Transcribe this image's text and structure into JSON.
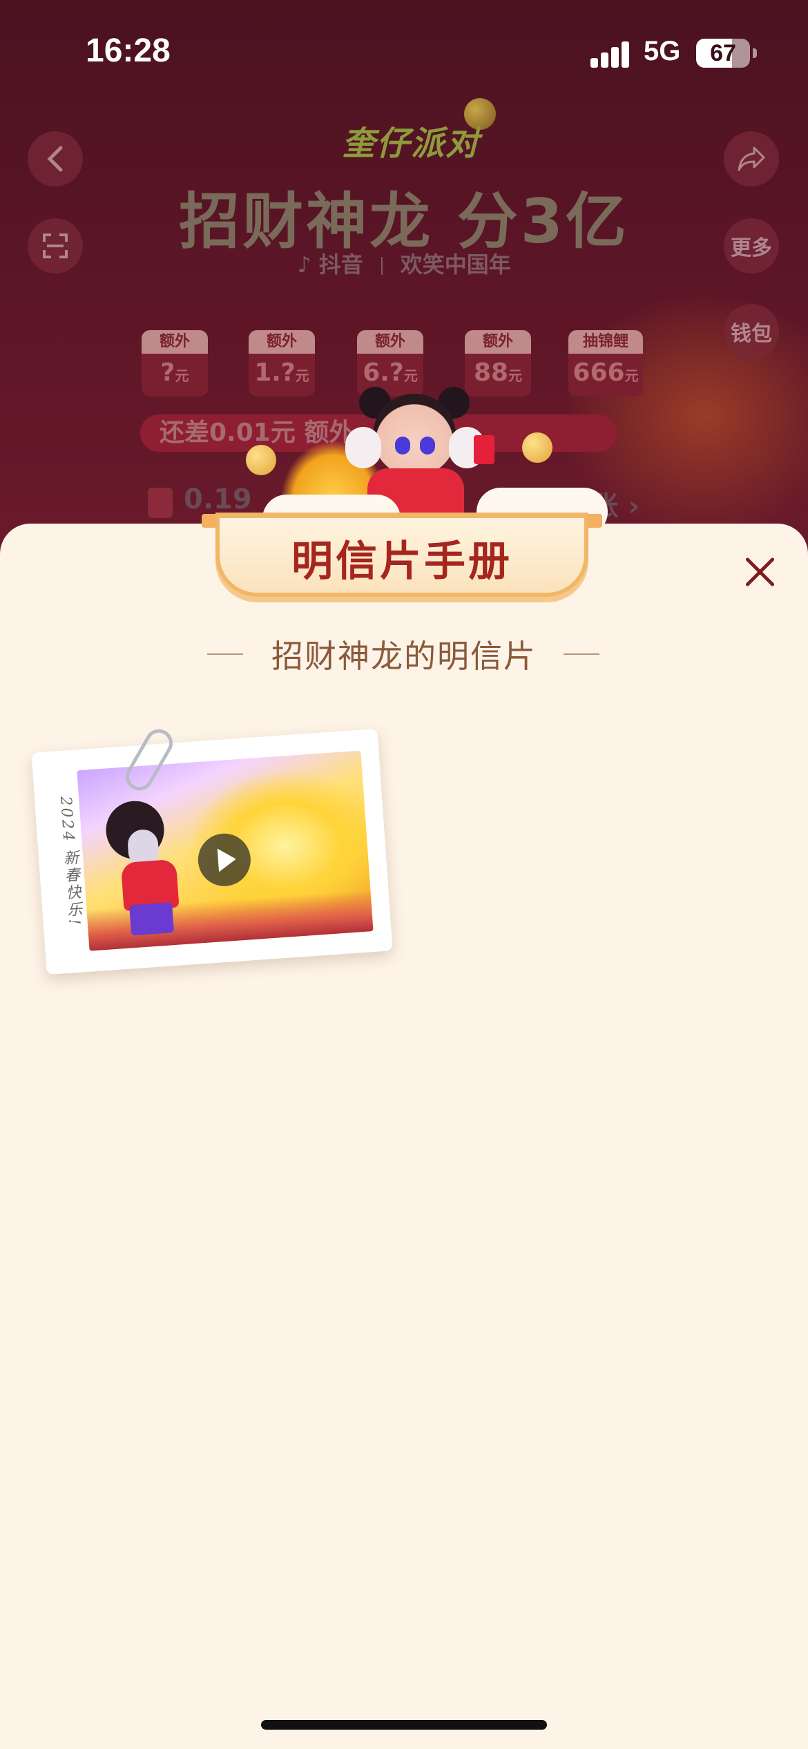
{
  "status_bar": {
    "time": "16:28",
    "network": "5G",
    "battery": "67",
    "battery_level": 0.67
  },
  "background": {
    "logo": "奎仔派对",
    "title": "招财神龙 分3亿",
    "subtitle_brand": "抖音",
    "subtitle_slogan": "欢笑中国年",
    "side_buttons": {
      "more": "更多",
      "wallet": "钱包"
    },
    "prizes": [
      {
        "label": "额外",
        "amount": "?",
        "unit": "元"
      },
      {
        "label": "额外",
        "amount": "1.?",
        "unit": "元"
      },
      {
        "label": "额外",
        "amount": "6.?",
        "unit": "元"
      },
      {
        "label": "额外",
        "amount": "88",
        "unit": "元"
      },
      {
        "label": "抽锦鲤",
        "amount": "666",
        "unit": "元"
      }
    ],
    "progress_text": "还差0.01元 额外",
    "arrival_left": "0.19",
    "arrival_right": "到账 ›"
  },
  "sheet": {
    "title": "明信片手册",
    "section_title": "招财神龙的明信片",
    "postcard_note": "2024 新春快乐!"
  }
}
